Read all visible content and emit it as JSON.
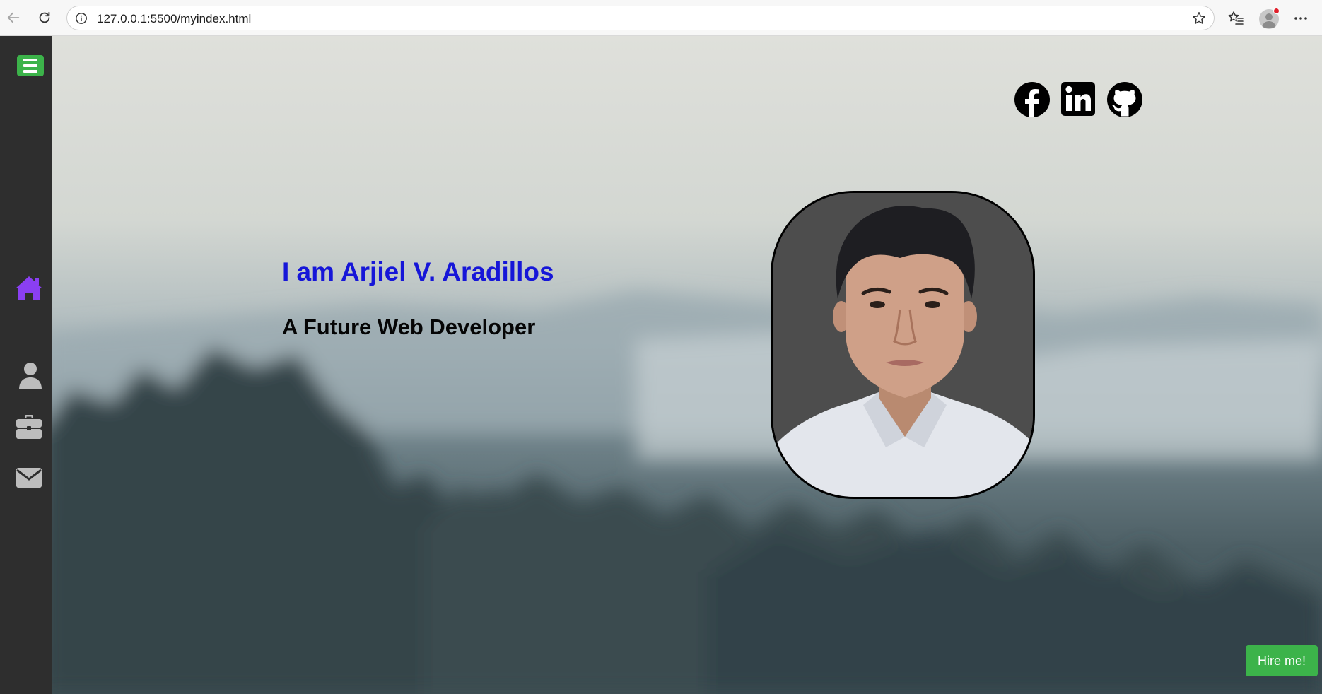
{
  "browser": {
    "url": "127.0.0.1:5500/myindex.html",
    "icons": [
      "back-arrow-icon",
      "reload-icon",
      "info-icon",
      "star-icon",
      "favorites-icon",
      "profile-avatar",
      "more-icon"
    ]
  },
  "sidebar": {
    "menu_icon": "menu-icon",
    "items": [
      {
        "icon": "home-icon",
        "active": true
      },
      {
        "icon": "user-icon",
        "active": false
      },
      {
        "icon": "briefcase-icon",
        "active": false
      },
      {
        "icon": "envelope-icon",
        "active": false
      }
    ]
  },
  "social": [
    {
      "icon": "facebook-icon"
    },
    {
      "icon": "linkedin-icon"
    },
    {
      "icon": "github-icon"
    }
  ],
  "hero": {
    "title": "I am Arjiel V. Aradillos",
    "subtitle": "A Future Web Developer"
  },
  "hire_button": {
    "label": "Hire me!"
  },
  "colors": {
    "accent_green": "#3cb34a",
    "active_icon": "#8a3ff2",
    "title_blue": "#1616d8",
    "sidebar_bg": "#2e2e2e"
  }
}
